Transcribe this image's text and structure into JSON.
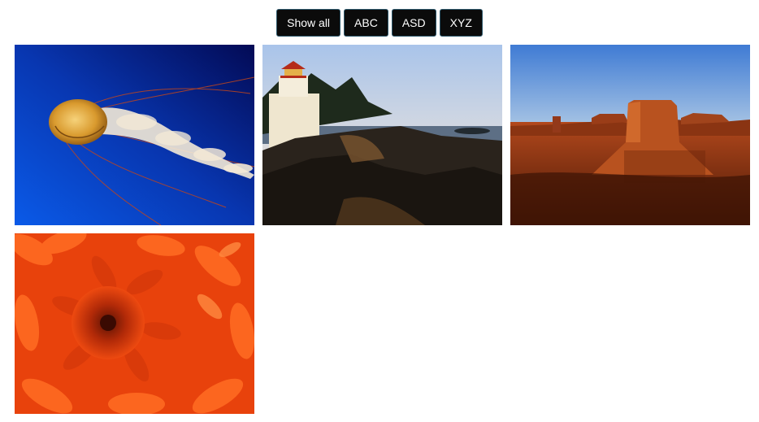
{
  "filters": {
    "buttons": [
      {
        "label": "Show all"
      },
      {
        "label": "ABC"
      },
      {
        "label": "ASD"
      },
      {
        "label": "XYZ"
      }
    ]
  },
  "gallery": {
    "items": [
      {
        "subject": "jellyfish-photo"
      },
      {
        "subject": "lighthouse-photo"
      },
      {
        "subject": "desert-butte-photo"
      },
      {
        "subject": "orange-flower-photo"
      }
    ]
  },
  "colors": {
    "button_bg": "#0b0b0b",
    "button_text": "#ffffff",
    "button_border": "#2f5a6e"
  }
}
